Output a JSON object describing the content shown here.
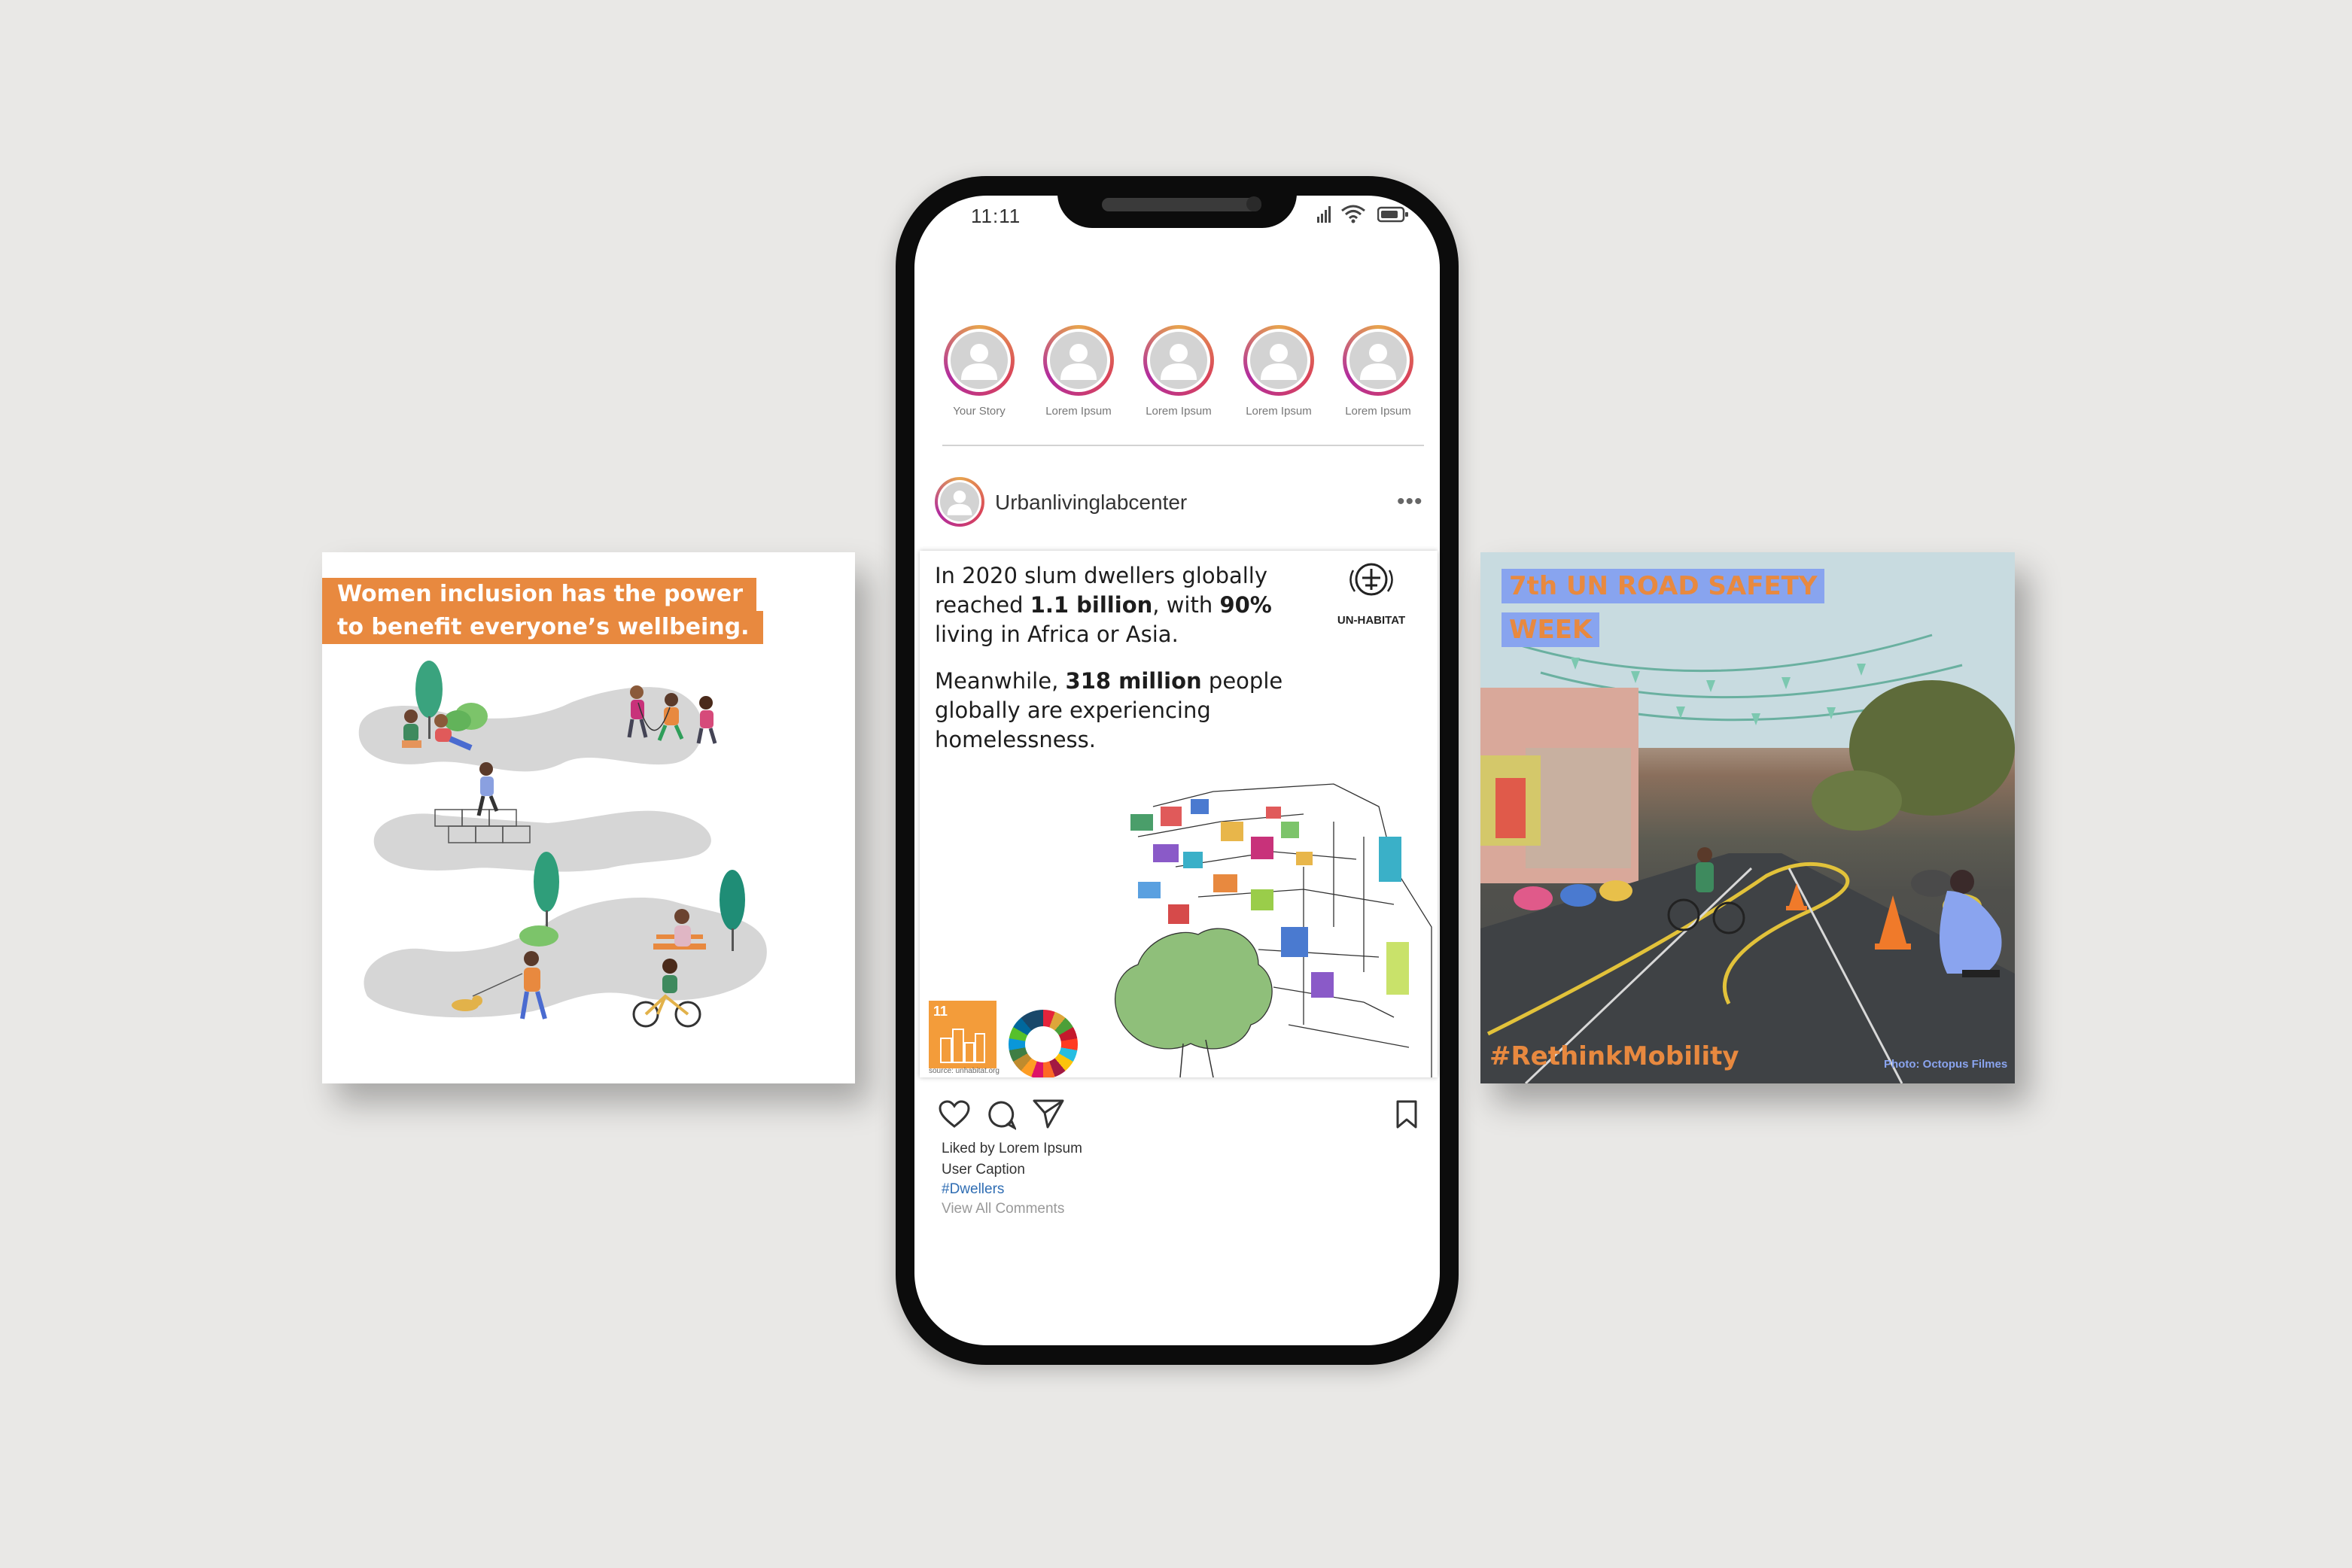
{
  "left_card": {
    "headline_line1": "Women inclusion has the power",
    "headline_line2": "to benefit everyone’s wellbeing."
  },
  "phone": {
    "status_time": "11:11",
    "stories": [
      {
        "label": "Your Story"
      },
      {
        "label": "Lorem Ipsum"
      },
      {
        "label": "Lorem Ipsum"
      },
      {
        "label": "Lorem Ipsum"
      },
      {
        "label": "Lorem Ipsum"
      }
    ],
    "post": {
      "username": "Urbanlivinglabcenter",
      "more": "•••",
      "text1_a": "In 2020 slum dwellers globally reached ",
      "text1_b": "1.1 billion",
      "text1_c": ", with ",
      "text1_d": "90%",
      "text1_e": " living in Africa or Asia.",
      "text2_a": "Meanwhile, ",
      "text2_b": "318 million",
      "text2_c": " people globally are experiencing homelessness.",
      "logo_label": "UN-HABITAT",
      "sdg_number": "11",
      "source": "source: unhabitat.org",
      "liked_by": "Liked by Lorem Ipsum",
      "caption": "User Caption",
      "hashtag": "#Dwellers",
      "view_all": "View All Comments"
    }
  },
  "right_card": {
    "title_line1": "7th UN ROAD SAFETY",
    "title_line2": "WEEK",
    "hashtag": "#RethinkMobility",
    "credit": "Photo: Octopus Filmes"
  },
  "colors": {
    "background": "#e9e8e6",
    "accent_orange": "#e8893f",
    "title_highlight_blue": "#88a4ef",
    "hashtag_blue": "#2f6db3"
  }
}
